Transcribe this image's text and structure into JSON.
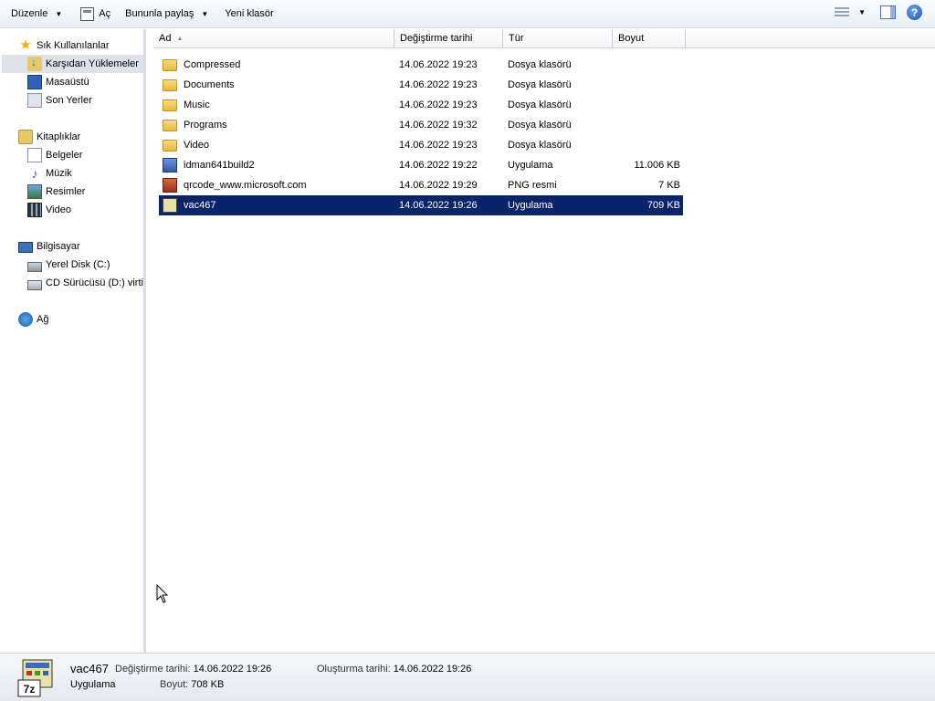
{
  "toolbar": {
    "organize": "Düzenle",
    "open": "Aç",
    "share_with": "Bununla paylaş",
    "new_folder": "Yeni klasör",
    "help": "?"
  },
  "nav": {
    "favorites": "Sık Kullanılanlar",
    "downloads": "Karşıdan Yüklemeler",
    "desktop": "Masaüstü",
    "recent": "Son Yerler",
    "libraries": "Kitaplıklar",
    "documents": "Belgeler",
    "music": "Müzik",
    "pictures": "Resimler",
    "videos": "Video",
    "computer": "Bilgisayar",
    "local_disk": "Yerel Disk (C:)",
    "cd_drive": "CD Sürücüsü (D:) virtio",
    "network": "Ağ"
  },
  "columns": {
    "name": "Ad",
    "modified": "Değiştirme tarihi",
    "type": "Tür",
    "size": "Boyut"
  },
  "files": [
    {
      "name": "Compressed",
      "modified": "14.06.2022 19:23",
      "type": "Dosya klasörü",
      "size": "",
      "icon": "folder-icon"
    },
    {
      "name": "Documents",
      "modified": "14.06.2022 19:23",
      "type": "Dosya klasörü",
      "size": "",
      "icon": "folder-icon"
    },
    {
      "name": "Music",
      "modified": "14.06.2022 19:23",
      "type": "Dosya klasörü",
      "size": "",
      "icon": "folder-icon"
    },
    {
      "name": "Programs",
      "modified": "14.06.2022 19:32",
      "type": "Dosya klasörü",
      "size": "",
      "icon": "folder-icon"
    },
    {
      "name": "Video",
      "modified": "14.06.2022 19:23",
      "type": "Dosya klasörü",
      "size": "",
      "icon": "folder-icon"
    },
    {
      "name": "idman641build2",
      "modified": "14.06.2022 19:22",
      "type": "Uygulama",
      "size": "11.006 KB",
      "icon": "installer-icon"
    },
    {
      "name": "qrcode_www.microsoft.com",
      "modified": "14.06.2022 19:29",
      "type": "PNG resmi",
      "size": "7 KB",
      "icon": "png-image-icon"
    },
    {
      "name": "vac467",
      "modified": "14.06.2022 19:26",
      "type": "Uygulama",
      "size": "709 KB",
      "icon": "7zip-sfx-icon",
      "selected": true
    }
  ],
  "details": {
    "name": "vac467",
    "type": "Uygulama",
    "modified_label": "Değiştirme tarihi:",
    "modified_value": "14.06.2022 19:26",
    "size_label": "Boyut:",
    "size_value": "708 KB",
    "created_label": "Oluşturma tarihi:",
    "created_value": "14.06.2022 19:26",
    "icon_text": "7z"
  },
  "colors": {
    "selection": "#0a246a",
    "nav_selection": "#dde2ea"
  }
}
